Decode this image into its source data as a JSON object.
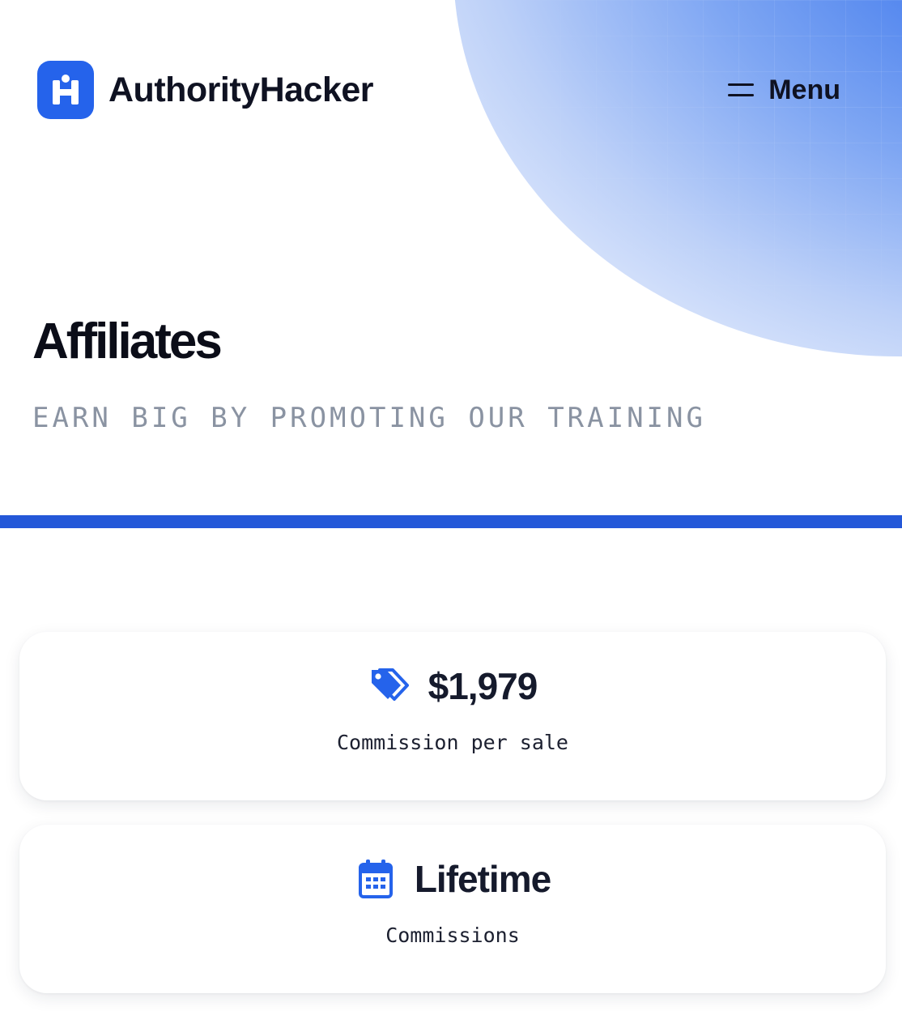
{
  "header": {
    "brand_name": "AuthorityHacker",
    "logo_icon": "h-logo-icon",
    "menu_label": "Menu",
    "menu_icon": "hamburger-icon"
  },
  "hero": {
    "title": "Affiliates",
    "subtitle": "EARN BIG BY PROMOTING OUR TRAINING"
  },
  "colors": {
    "accent": "#2563eb",
    "divider": "#2458d8",
    "heading": "#0b0d18",
    "subtitle": "#8a93a2"
  },
  "stats": [
    {
      "icon": "price-tags-icon",
      "value": "$1,979",
      "caption": "Commission per sale"
    },
    {
      "icon": "calendar-icon",
      "value": "Lifetime",
      "caption": "Commissions"
    }
  ]
}
